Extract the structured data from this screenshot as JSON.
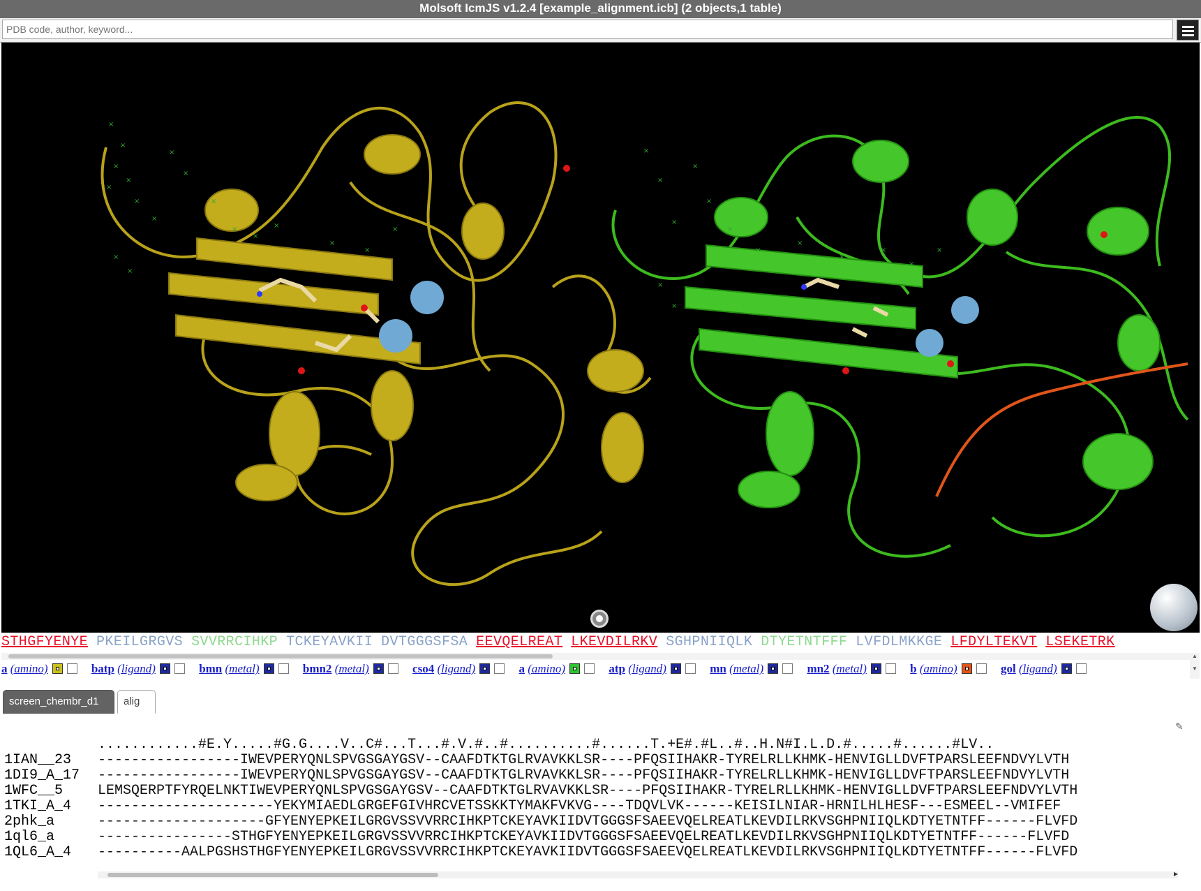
{
  "window": {
    "title": "Molsoft IcmJS v1.2.4 [example_alignment.icb] (2 objects,1 table)"
  },
  "search": {
    "placeholder": "PDB code, author, keyword..."
  },
  "viewer": {
    "background": "#000000",
    "structures": [
      {
        "name": "yellow-protein",
        "color": "#b8a21a"
      },
      {
        "name": "green-protein",
        "color": "#3dbb1e"
      }
    ],
    "ligand_colors": {
      "carbon": "#e9d9a6",
      "oxygen": "#e01616",
      "nitrogen": "#2b3cff",
      "metal": "#6fa9d4"
    },
    "peptide_color": "#e0551a"
  },
  "sequence_strip": {
    "segments": [
      {
        "text": "STHGFYENYE",
        "style": "red"
      },
      {
        "text": "PKEILGRGVS",
        "style": "blue"
      },
      {
        "text": "SVVRRCIHKP",
        "style": "green"
      },
      {
        "text": "TCKEYAVKII",
        "style": "blue"
      },
      {
        "text": "DVTGGGSFSA",
        "style": "blue"
      },
      {
        "text": "EEVQELREAT",
        "style": "red"
      },
      {
        "text": "LKEVDILRKV",
        "style": "red"
      },
      {
        "text": "SGHPNIIQLK",
        "style": "blue"
      },
      {
        "text": "DTYETNTFFF",
        "style": "green"
      },
      {
        "text": "LVFDLMKKGE",
        "style": "blue"
      },
      {
        "text": "LFDYLTEKVT",
        "style": "red"
      },
      {
        "text": "LSEKETRK",
        "style": "red"
      }
    ]
  },
  "objects": [
    {
      "name": "a",
      "type": "(amino)",
      "color": "#c9c11a"
    },
    {
      "name": "batp",
      "type": "(ligand)",
      "color": "#1e2a9c"
    },
    {
      "name": "bmn",
      "type": "(metal)",
      "color": "#1e2a9c"
    },
    {
      "name": "bmn2",
      "type": "(metal)",
      "color": "#1e2a9c"
    },
    {
      "name": "cso4",
      "type": "(ligand)",
      "color": "#1e2a9c"
    },
    {
      "name": "a",
      "type": "(amino)",
      "color": "#2ec22e"
    },
    {
      "name": "atp",
      "type": "(ligand)",
      "color": "#1e2a9c"
    },
    {
      "name": "mn",
      "type": "(metal)",
      "color": "#1e2a9c"
    },
    {
      "name": "mn2",
      "type": "(metal)",
      "color": "#1e2a9c"
    },
    {
      "name": "b",
      "type": "(amino)",
      "color": "#e0551a"
    },
    {
      "name": "gol",
      "type": "(ligand)",
      "color": "#1e2a9c"
    }
  ],
  "tabs": [
    {
      "label": "screen_chembr_d1",
      "active": false
    },
    {
      "label": "alig",
      "active": true
    }
  ],
  "alignment": {
    "consensus": "............#E.Y.....#G.G....V..C#...T...#.V.#..#..........#......T.+E#.#L..#..H.N#I.L.D.#.....#......#LV..",
    "rows": [
      {
        "name": "1IAN__23",
        "seq": "-----------------IWEVPERYQNLSPVGSGAYGSV--CAAFDTKTGLRVAVKKLSR----PFQSIIHAKR-TYRELRLLKHMK-HENVIGLLDVFTPARSLEEFNDVYLVTH"
      },
      {
        "name": "1DI9_A_17",
        "seq": "-----------------IWEVPERYQNLSPVGSGAYGSV--CAAFDTKTGLRVAVKKLSR----PFQSIIHAKR-TYRELRLLKHMK-HENVIGLLDVFTPARSLEEFNDVYLVTH"
      },
      {
        "name": "1WFC__5",
        "seq": "LEMSQERPTFYRQELNKTIWEVPERYQNLSPVGSGAYGSV--CAAFDTKTGLRVAVKKLSR----PFQSIIHAKR-TYRELRLLKHMK-HENVIGLLDVFTPARSLEEFNDVYLVTH"
      },
      {
        "name": "1TKI_A_4",
        "seq": "---------------------YEKYMIAEDLGRGEFGIVHRCVETSSKKTYMAKFVKVG----TDQVLVK------KEISILNIAR-HRNILHLHESF---ESMEEL--VMIFEF"
      },
      {
        "name": "2phk_a",
        "seq": "--------------------GFYENYEPKEILGRGVSSVVRRCIHKPTCKEYAVKIIDVTGGGSFSAEEVQELREATLKEVDILRKVSGHPNIIQLKDTYETNTFF------FLVFD"
      },
      {
        "name": "1ql6_a",
        "seq": "----------------STHGFYENYEPKEILGRGVSSVVRRCIHKPTCKEYAVKIIDVTGGGSFSAEEVQELREATLKEVDILRKVSGHPNIIQLKDTYETNTFF------FLVFD"
      },
      {
        "name": "1QL6_A_4",
        "seq": "----------AALPGSHSTHGFYENYEPKEILGRGVSSVVRRCIHKPTCKEYAVKIIDVTGGGSFSAEEVQELREATLKEVDILRKVSGHPNIIQLKDTYETNTFF------FLVFD"
      }
    ],
    "highlight_colors": {
      "light": "#f8fbd0",
      "green": "#7fe87f",
      "teal": "#2fb98f",
      "blue": "#8fa8e8"
    }
  }
}
